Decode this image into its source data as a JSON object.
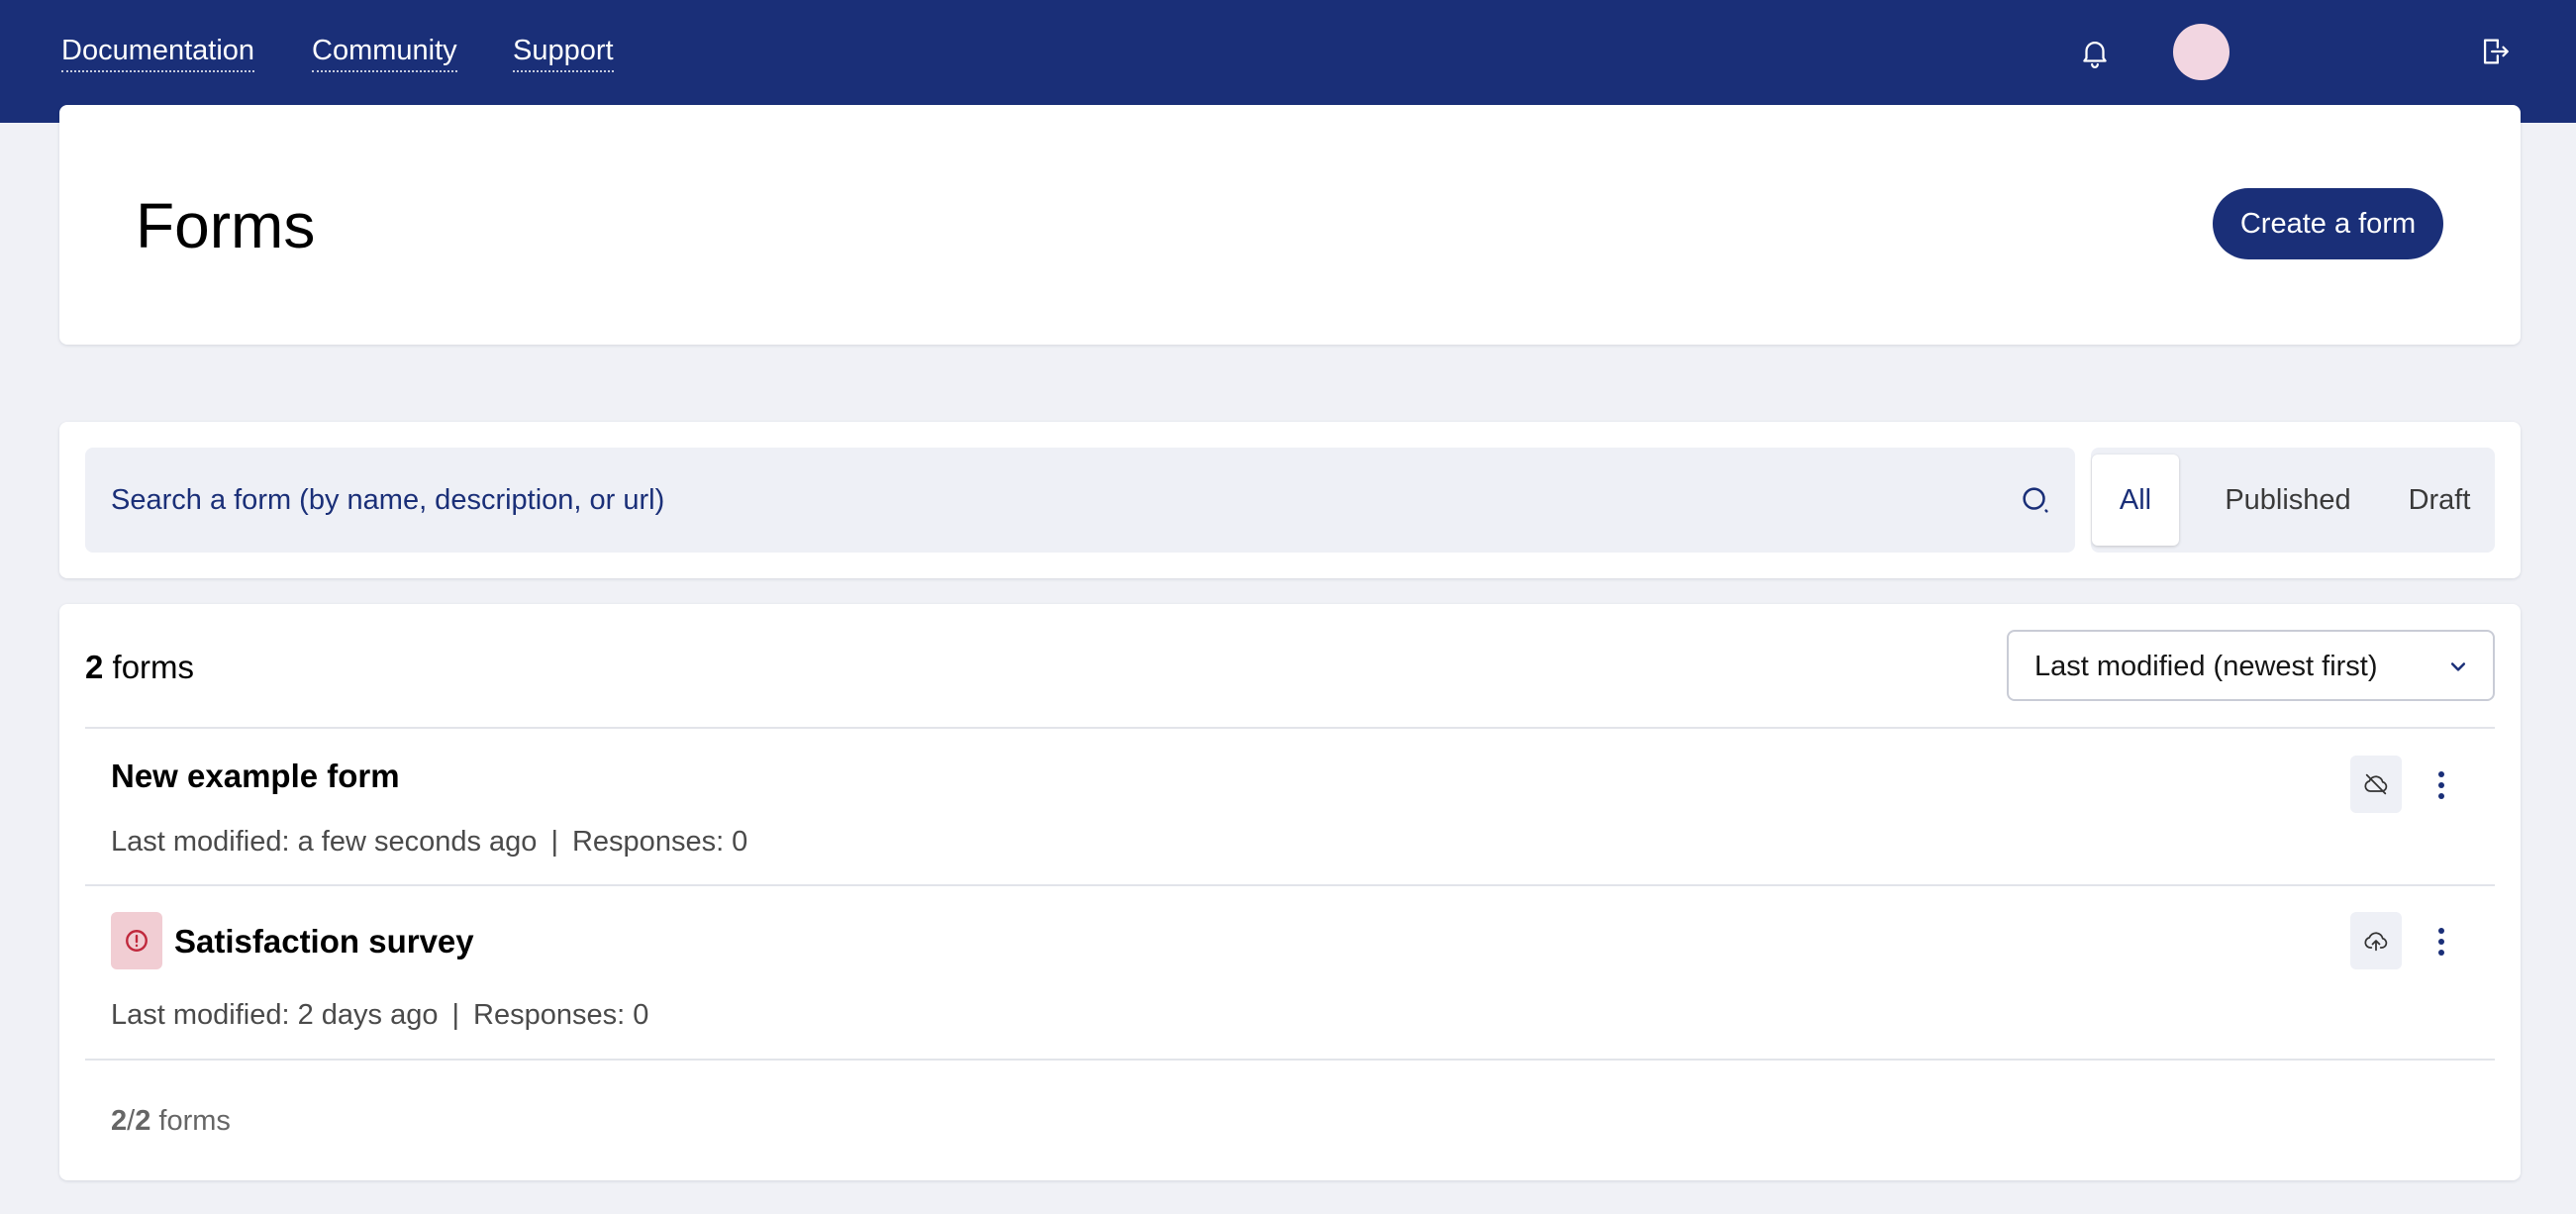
{
  "nav": {
    "links": [
      "Documentation",
      "Community",
      "Support"
    ],
    "bell_icon": "bell-icon",
    "logout_icon": "logout-icon"
  },
  "header": {
    "title": "Forms",
    "create_label": "Create a form"
  },
  "search": {
    "placeholder": "Search a form (by name, description, or url)",
    "value": ""
  },
  "filters": {
    "tabs": [
      "All",
      "Published",
      "Draft"
    ],
    "selected": "All"
  },
  "list": {
    "count": "2",
    "count_label": "forms",
    "sort_label": "Last modified (newest first)",
    "items": [
      {
        "title": "New example form",
        "modified": "Last modified: a few seconds ago",
        "responses": "Responses: 0",
        "status_icon": "cloud-off-icon"
      },
      {
        "title": "Satisfaction survey",
        "modified": "Last modified: 2 days ago",
        "responses": "Responses: 0",
        "status_icon": "cloud-upload-icon",
        "alert_icon": "alert-circle-icon"
      }
    ],
    "footer_shown": "2",
    "footer_total": "2",
    "footer_label": "forms"
  },
  "colors": {
    "brand": "#1a2f78",
    "background": "#f0f1f6",
    "alert": "#c0283c",
    "alert_bg": "#f1cdd3"
  }
}
